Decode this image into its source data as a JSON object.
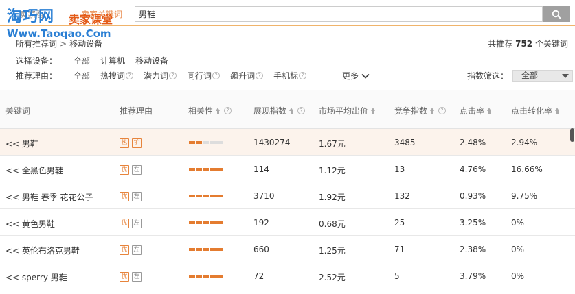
{
  "top": {
    "tab_a": "卖家看",
    "tab_b": "卖家关键词",
    "search_value": "男鞋"
  },
  "watermark": {
    "logo": "淘巧网",
    "slogan": "卖家课堂",
    "url": "Www.Taoqao.Com"
  },
  "breadcrumb": {
    "root": "所有推荐词",
    "sep": ">",
    "current": "移动设备"
  },
  "summary": {
    "prefix": "共推荐",
    "count": "752",
    "suffix": "个关键词"
  },
  "device_filter": {
    "label": "选择设备：",
    "options": [
      "全部",
      "计算机",
      "移动设备"
    ]
  },
  "reason_filter": {
    "label": "推荐理由：",
    "options": [
      {
        "label": "全部",
        "help": false
      },
      {
        "label": "热搜词",
        "help": true
      },
      {
        "label": "潜力词",
        "help": true
      },
      {
        "label": "同行词",
        "help": true
      },
      {
        "label": "飙升词",
        "help": true
      },
      {
        "label": "手机标",
        "help": true
      }
    ],
    "more": "更多"
  },
  "index_filter": {
    "label": "指数筛选：",
    "value": "全部"
  },
  "table": {
    "headers": {
      "keyword": "关键词",
      "reason": "推荐理由",
      "relevance": "相关性",
      "impressions": "展现指数",
      "avg_bid": "市场平均出价",
      "competition": "竞争指数",
      "ctr": "点击率",
      "cvr": "点击转化率"
    },
    "rows": [
      {
        "keyword": "<< 男鞋",
        "tags": [
          "热",
          "扩"
        ],
        "tag_styles": [
          "o",
          "o"
        ],
        "relevance": 2,
        "impressions": "1430274",
        "avg_bid": "1.67元",
        "competition": "3485",
        "ctr": "2.48%",
        "cvr": "2.94%",
        "highlight": true
      },
      {
        "keyword": "<< 全黑色男鞋",
        "tags": [
          "优",
          "左"
        ],
        "tag_styles": [
          "o",
          "g"
        ],
        "relevance": 5,
        "impressions": "114",
        "avg_bid": "1.12元",
        "competition": "13",
        "ctr": "4.76%",
        "cvr": "16.66%"
      },
      {
        "keyword": "<< 男鞋 春季 花花公子",
        "tags": [
          "优",
          "左"
        ],
        "tag_styles": [
          "o",
          "g"
        ],
        "relevance": 5,
        "impressions": "3710",
        "avg_bid": "1.92元",
        "competition": "132",
        "ctr": "0.93%",
        "cvr": "9.75%"
      },
      {
        "keyword": "<< 黄色男鞋",
        "tags": [
          "优",
          "左"
        ],
        "tag_styles": [
          "o",
          "g"
        ],
        "relevance": 5,
        "impressions": "192",
        "avg_bid": "0.68元",
        "competition": "25",
        "ctr": "3.25%",
        "cvr": "0%"
      },
      {
        "keyword": "<< 英伦布洛克男鞋",
        "tags": [
          "优",
          "左"
        ],
        "tag_styles": [
          "o",
          "g"
        ],
        "relevance": 5,
        "impressions": "660",
        "avg_bid": "1.25元",
        "competition": "71",
        "ctr": "2.38%",
        "cvr": "0%"
      },
      {
        "keyword": "<< sperry 男鞋",
        "tags": [
          "优",
          "左"
        ],
        "tag_styles": [
          "o",
          "g"
        ],
        "relevance": 5,
        "impressions": "72",
        "avg_bid": "2.52元",
        "competition": "5",
        "ctr": "3.79%",
        "cvr": "0%"
      }
    ]
  },
  "colors": {
    "accent": "#e47c30",
    "highlight_row": "#fcf3ec",
    "logo_blue": "#2a7fd4"
  }
}
